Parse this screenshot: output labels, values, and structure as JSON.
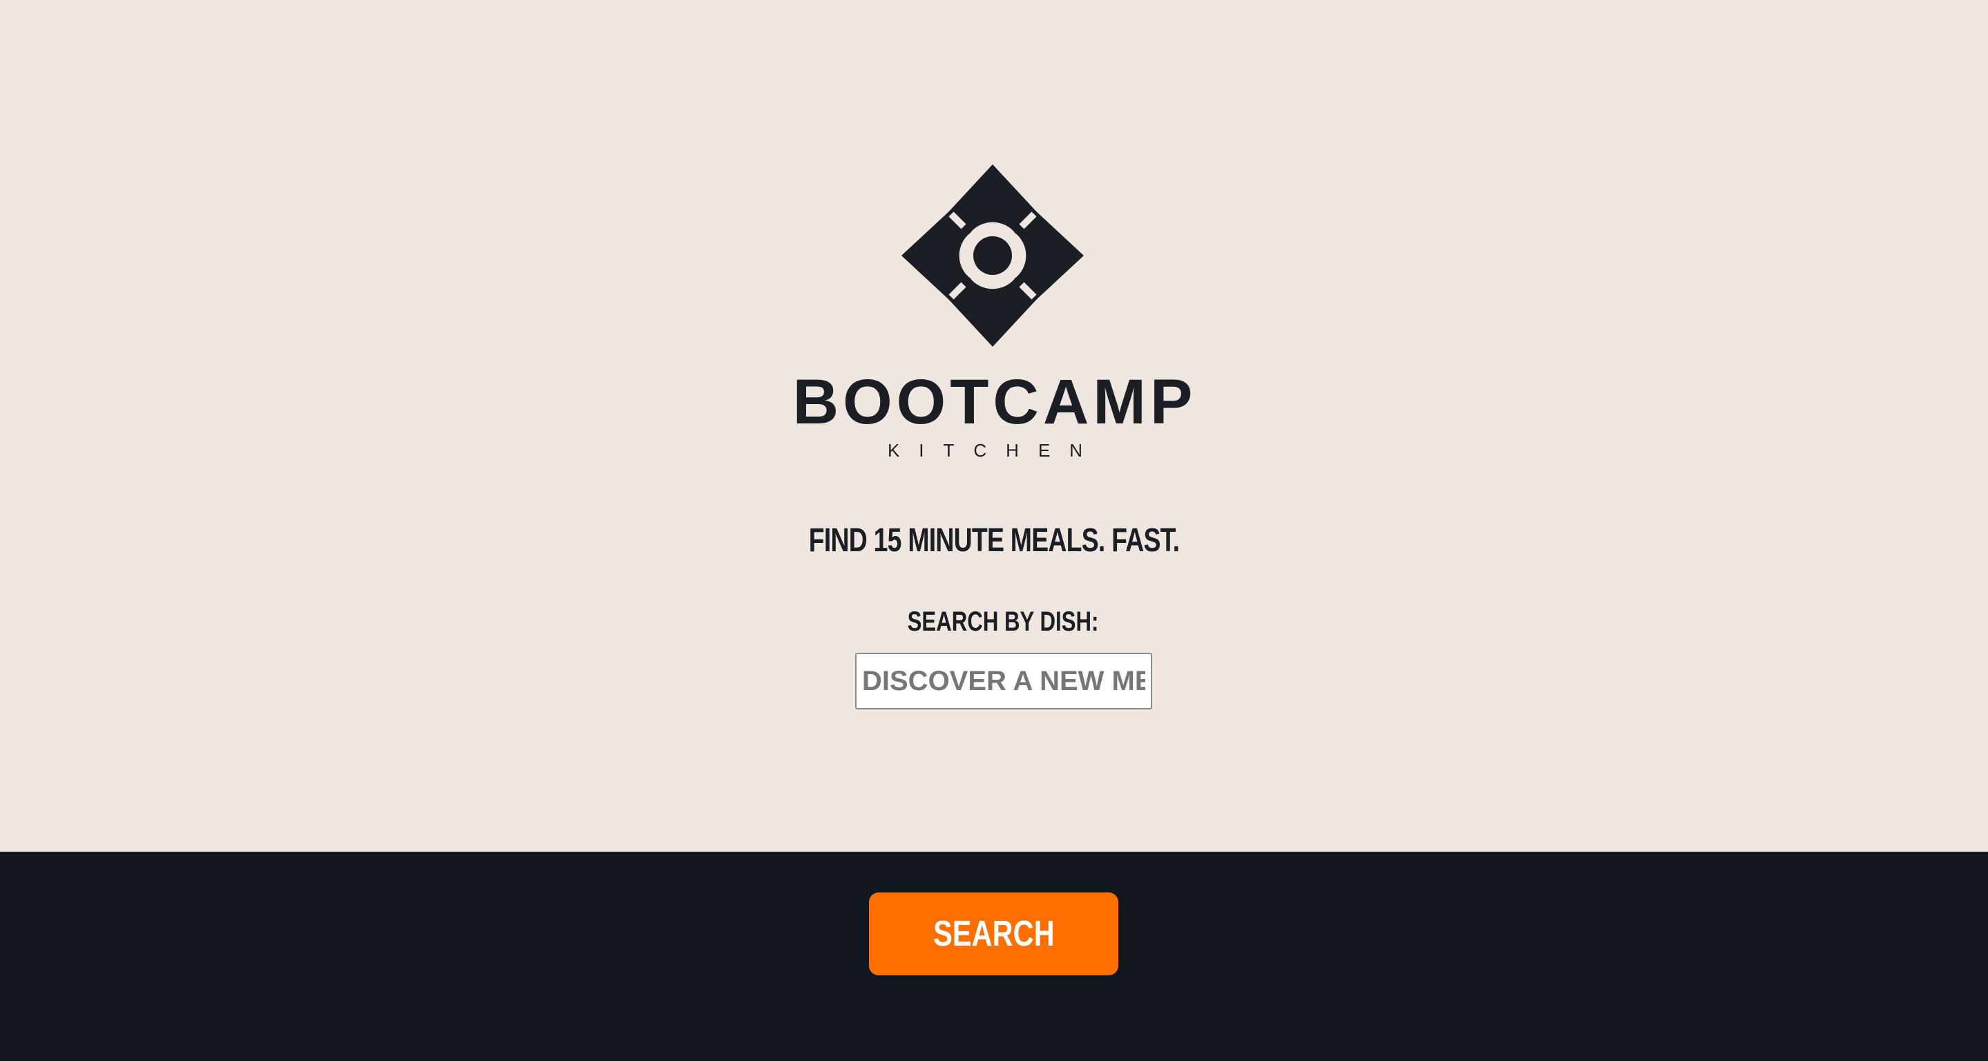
{
  "brand": {
    "name": "BOOTCAMP",
    "subtitle": "KITCHEN",
    "icon": "flower-diamond-icon",
    "color": "#1b1f25"
  },
  "hero": {
    "tagline": "FIND 15 MINUTE MEALS. FAST.",
    "search_label": "SEARCH BY DISH:",
    "search_placeholder": "DISCOVER A NEW MEAL...",
    "search_value": ""
  },
  "footer": {
    "search_button_label": "SEARCH"
  },
  "colors": {
    "background": "#f0e6e0",
    "footer": "#12171f",
    "accent": "#ff6f00",
    "text": "#1b1f25"
  }
}
